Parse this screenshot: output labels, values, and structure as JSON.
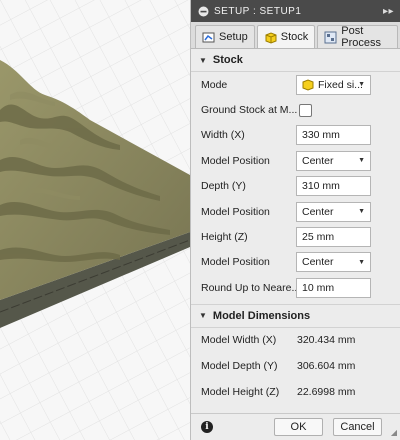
{
  "titlebar": {
    "title": "SETUP : SETUP1",
    "expand_glyph": "▸▸"
  },
  "tabs": [
    {
      "label": "Setup",
      "icon": "setup-icon",
      "active": false
    },
    {
      "label": "Stock",
      "icon": "stock-cube-icon",
      "active": true
    },
    {
      "label": "Post Process",
      "icon": "post-process-icon",
      "active": false
    }
  ],
  "stock": {
    "heading": "Stock",
    "mode": {
      "label": "Mode",
      "value": "Fixed si..."
    },
    "ground_stock": {
      "label": "Ground Stock at M...",
      "checked": false
    },
    "width": {
      "label": "Width (X)",
      "value": "330 mm"
    },
    "model_position_x": {
      "label": "Model Position",
      "value": "Center"
    },
    "depth": {
      "label": "Depth (Y)",
      "value": "310 mm"
    },
    "model_position_y": {
      "label": "Model Position",
      "value": "Center"
    },
    "height": {
      "label": "Height (Z)",
      "value": "25 mm"
    },
    "model_position_z": {
      "label": "Model Position",
      "value": "Center"
    },
    "round_up": {
      "label": "Round Up to Neare...",
      "value": "10 mm"
    }
  },
  "model_dimensions": {
    "heading": "Model Dimensions",
    "width": {
      "label": "Model Width (X)",
      "value": "320.434 mm"
    },
    "depth": {
      "label": "Model Depth (Y)",
      "value": "306.604 mm"
    },
    "height": {
      "label": "Model Height (Z)",
      "value": "22.6998 mm"
    }
  },
  "footer": {
    "ok": "OK",
    "cancel": "Cancel"
  },
  "colors": {
    "titlebar": "#4a4a4a",
    "panel_bg": "#ececec",
    "model_top": "#807e56",
    "model_side": "#5b5b45",
    "stock_cube": "#f5cf1e"
  }
}
